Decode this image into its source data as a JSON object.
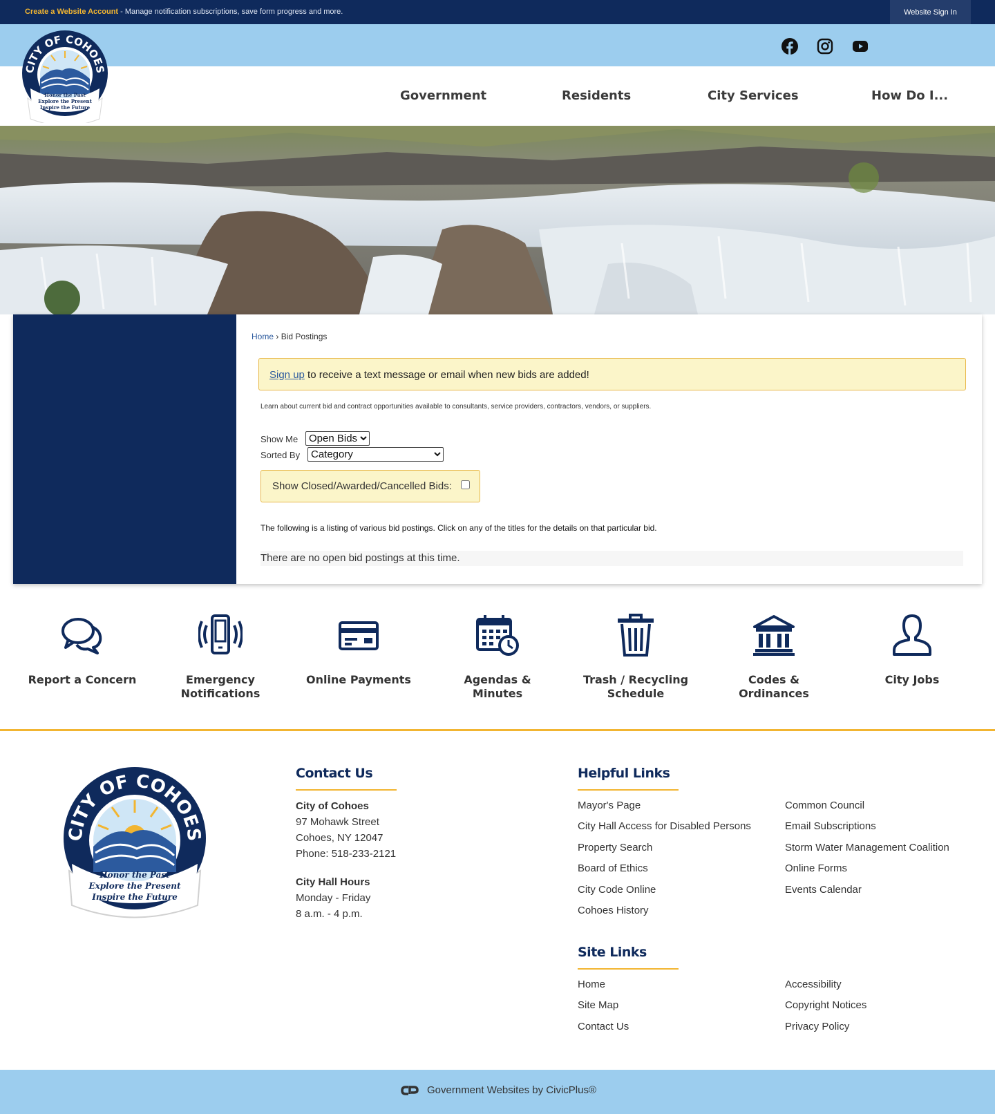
{
  "topbar": {
    "create_account": "Create a Website Account",
    "create_account_desc": " - Manage notification subscriptions, save form progress and more.",
    "signin": "Website Sign In"
  },
  "social": [
    "facebook-icon",
    "instagram-icon",
    "youtube-icon"
  ],
  "nav": {
    "government": "Government",
    "residents": "Residents",
    "city_services": "City Services",
    "how_do_i": "How Do I..."
  },
  "logo": {
    "name": "CITY OF COHOES",
    "motto": [
      "Honor the Past",
      "Explore the Present",
      "Inspire the Future"
    ]
  },
  "breadcrumb": {
    "home": "Home",
    "sep": " › ",
    "current": "Bid Postings"
  },
  "signup": {
    "link": "Sign up",
    "text": " to receive a text message or email when new bids are added!"
  },
  "learn": "Learn about current bid and contract opportunities available to consultants, service providers, contractors, vendors, or suppliers.",
  "filters": {
    "show_me_label": "Show Me",
    "show_me_value": "Open Bids",
    "sorted_by_label": "Sorted By",
    "sorted_by_value": "Category",
    "closed_label": "Show Closed/Awarded/Cancelled Bids:"
  },
  "listing_text": "The following is a listing of various bid postings. Click on any of the titles for the details on that particular bid.",
  "no_bids": "There are no open bid postings at this time.",
  "quick_links": [
    {
      "label1": "Report a Concern",
      "label2": "",
      "icon": "chat-bubbles-icon"
    },
    {
      "label1": "Emergency",
      "label2": "Notifications",
      "icon": "phone-vibrate-icon"
    },
    {
      "label1": "Online Payments",
      "label2": "",
      "icon": "credit-card-icon"
    },
    {
      "label1": "Agendas &",
      "label2": "Minutes",
      "icon": "calendar-clock-icon"
    },
    {
      "label1": "Trash / Recycling",
      "label2": "Schedule",
      "icon": "trash-can-icon"
    },
    {
      "label1": "Codes &",
      "label2": "Ordinances",
      "icon": "building-columns-icon"
    },
    {
      "label1": "City Jobs",
      "label2": "",
      "icon": "person-icon"
    }
  ],
  "contact": {
    "heading": "Contact Us",
    "org": "City of Cohoes",
    "street": "97 Mohawk Street",
    "city": "Cohoes, NY 12047",
    "phone": "Phone: 518-233-2121",
    "hours_heading": "City Hall Hours",
    "days": "Monday - Friday",
    "hours": "8 a.m. - 4 p.m."
  },
  "helpful_links": {
    "heading": "Helpful Links",
    "col1": [
      "Mayor's Page",
      "City Hall Access for Disabled Persons",
      "Property Search",
      "Board of Ethics",
      "City Code Online",
      "Cohoes History"
    ],
    "col2": [
      "Common Council",
      "Email Subscriptions",
      "Storm Water Management Coalition",
      "Online Forms",
      "Events Calendar"
    ]
  },
  "site_links": {
    "heading": "Site Links",
    "col1": [
      "Home",
      "Site Map",
      "Contact Us"
    ],
    "col2": [
      "Accessibility",
      "Copyright Notices",
      "Privacy Policy"
    ]
  },
  "footer_credit": "Government Websites by CivicPlus®",
  "colors": {
    "navy": "#0f2a5c",
    "light_blue": "#9ccdee",
    "gold": "#f2b531",
    "cream": "#fbf5c9"
  }
}
